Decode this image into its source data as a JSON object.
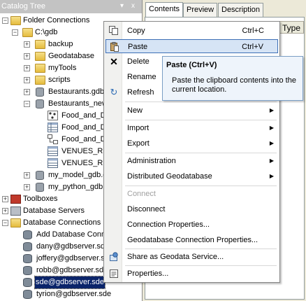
{
  "catalog": {
    "title": "Catalog Tree",
    "pin_glyph": "▾",
    "close_glyph": "x",
    "tree": {
      "folder_connections": "Folder Connections",
      "c_gdb": "C:\\gdb",
      "backup": "backup",
      "geodatabase": "Geodatabase",
      "mytools": "myTools",
      "scripts": "scripts",
      "bestaurants_gdb": "Bestaurants.gdb",
      "bestaurants_new": "Bestaurants_new",
      "food1": "Food_and_D",
      "food2": "Food_and_D",
      "food3": "Food_and_D",
      "venues1": "VENUES_REL",
      "venues2": "VENUES_REV",
      "my_model_gdb": "my_model_gdb.g",
      "my_python_gdb": "my_python_gdb",
      "toolboxes": "Toolboxes",
      "database_servers": "Database Servers",
      "database_connections": "Database Connections",
      "add_db_conn": "Add Database Conne",
      "dany": "dany@gdbserver.sd",
      "joffery": "joffery@gdbserver.s",
      "robb": "robb@gdbserver.sde",
      "sde": "sde@gdbserver.sde",
      "tyrion": "tyrion@gdbserver.sde"
    },
    "toggle_plus": "+",
    "toggle_minus": "−"
  },
  "right_panel": {
    "tabs": [
      "Contents",
      "Preview",
      "Description"
    ],
    "column_header": "Type"
  },
  "menu": {
    "copy": "Copy",
    "copy_key": "Ctrl+C",
    "paste": "Paste",
    "paste_key": "Ctrl+V",
    "delete": "Delete",
    "rename": "Rename",
    "refresh": "Refresh",
    "new": "New",
    "import": "Import",
    "export": "Export",
    "administration": "Administration",
    "distributed_geodatabase": "Distributed Geodatabase",
    "connect": "Connect",
    "disconnect": "Disconnect",
    "connection_properties": "Connection Properties...",
    "geodatabase_connection_properties": "Geodatabase Connection Properties...",
    "share_as_geodata_service": "Share as Geodata Service...",
    "properties": "Properties...",
    "submenu_arrow": "▶"
  },
  "tooltip": {
    "title": "Paste (Ctrl+V)",
    "body": "Paste the clipboard contents into the current location."
  },
  "colors": {
    "selection": "#0a246a",
    "menu_hover": "#d6e4f5",
    "tooltip_bg": "#eef4fb"
  }
}
